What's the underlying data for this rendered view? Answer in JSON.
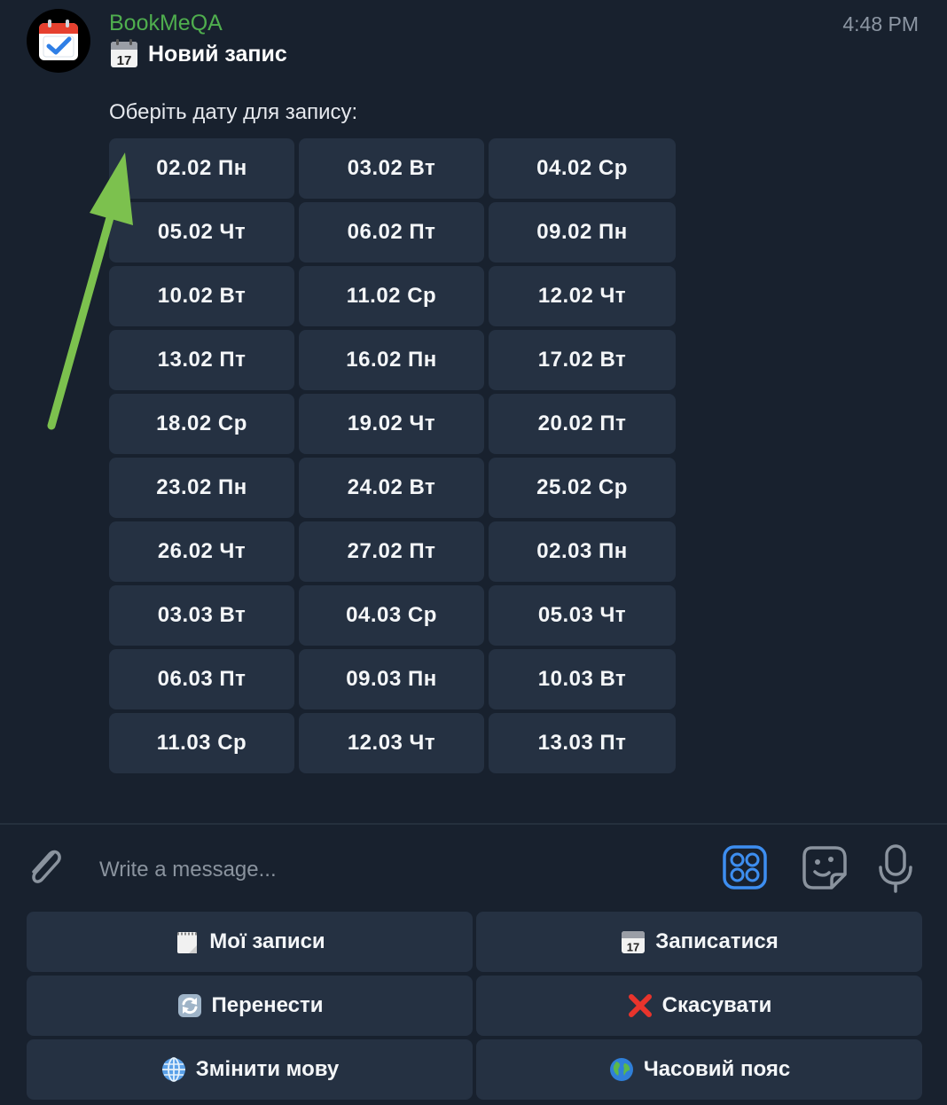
{
  "chat": {
    "sender": "BookMeQA",
    "time": "4:48 PM",
    "title_icon": "calendar-17-emoji",
    "title": "Новий запис",
    "prompt": "Оберіть дату для запису:"
  },
  "dates": [
    "02.02 Пн",
    "03.02 Вт",
    "04.02 Ср",
    "05.02 Чт",
    "06.02 Пт",
    "09.02 Пн",
    "10.02 Вт",
    "11.02 Ср",
    "12.02 Чт",
    "13.02 Пт",
    "16.02 Пн",
    "17.02 Вт",
    "18.02 Ср",
    "19.02 Чт",
    "20.02 Пт",
    "23.02 Пн",
    "24.02 Вт",
    "25.02 Ср",
    "26.02 Чт",
    "27.02 Пт",
    "02.03 Пн",
    "03.03 Вт",
    "04.03 Ср",
    "05.03 Чт",
    "06.03 Пт",
    "09.03 Пн",
    "10.03 Вт",
    "11.03 Ср",
    "12.03 Чт",
    "13.03 Пт"
  ],
  "input": {
    "placeholder": "Write a message..."
  },
  "keyboard": [
    {
      "icon": "notepad-emoji",
      "label": "Мої записи"
    },
    {
      "icon": "calendar-emoji",
      "label": "Записатися"
    },
    {
      "icon": "refresh-emoji",
      "label": "Перенести"
    },
    {
      "icon": "cross-mark-emoji",
      "label": "Скасувати"
    },
    {
      "icon": "globe-meridians-emoji",
      "label": "Змінити мову"
    },
    {
      "icon": "earth-globe-emoji",
      "label": "Часовий пояс"
    }
  ],
  "colors": {
    "background": "#18212e",
    "button": "#253142",
    "sender": "#4fae4e",
    "accent": "#3d8ef0",
    "arrow": "#7cc14e"
  }
}
